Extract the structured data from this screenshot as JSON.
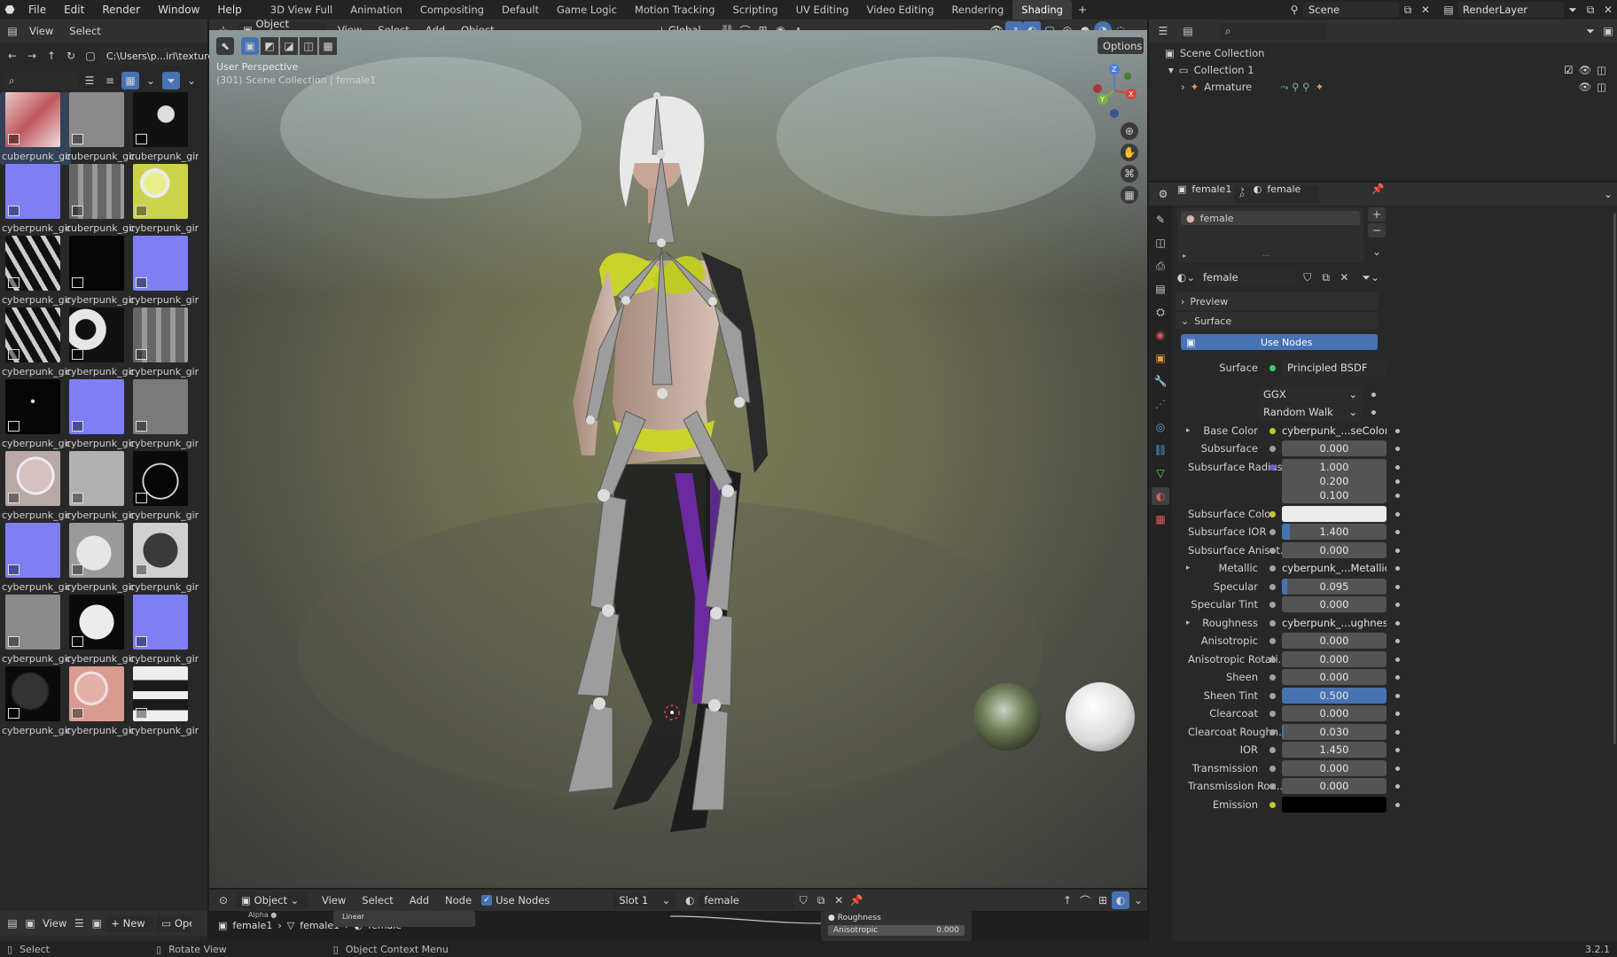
{
  "topbar": {
    "menus": [
      "File",
      "Edit",
      "Render",
      "Window",
      "Help"
    ],
    "workspaces": [
      "3D View Full",
      "Animation",
      "Compositing",
      "Default",
      "Game Logic",
      "Motion Tracking",
      "Scripting",
      "UV Editing",
      "Video Editing",
      "Rendering",
      "Shading"
    ],
    "active_workspace": "Shading",
    "scene": "Scene",
    "render_layer": "RenderLayer"
  },
  "filebrowser": {
    "menus": [
      "View",
      "Select"
    ],
    "path": "C:\\Users\\p...irl\\textures\\",
    "items": [
      {
        "label": "cuberpunk_gir",
        "kind": "redcloth"
      },
      {
        "label": "cuberpunk_gir",
        "kind": "gray"
      },
      {
        "label": "cuberpunk_gir",
        "kind": "blackmask"
      },
      {
        "label": "cyberpunk_gir",
        "kind": "normal"
      },
      {
        "label": "cuberpunk_gir",
        "kind": "grayuv"
      },
      {
        "label": "cyberpunk_gir",
        "kind": "yellow"
      },
      {
        "label": "cyberpunk_gir",
        "kind": "bwmask"
      },
      {
        "label": "cyberpunk_gir",
        "kind": "black"
      },
      {
        "label": "cyberpunk_gir",
        "kind": "normal"
      },
      {
        "label": "cyberpunk_gir",
        "kind": "bwmask"
      },
      {
        "label": "cyberpunk_gir",
        "kind": "bwuv"
      },
      {
        "label": "cyberpunk_gir",
        "kind": "grayuv"
      },
      {
        "label": "cyberpunk_gir",
        "kind": "blackdot"
      },
      {
        "label": "cyberpunk_gir",
        "kind": "normal"
      },
      {
        "label": "cyberpunk_gir",
        "kind": "graynoise"
      },
      {
        "label": "cyberpunk_gir",
        "kind": "eye"
      },
      {
        "label": "cyberpunk_gir",
        "kind": "lightgray"
      },
      {
        "label": "cyberpunk_gir",
        "kind": "blackcircle"
      },
      {
        "label": "cyberpunk_gir",
        "kind": "normal"
      },
      {
        "label": "cyberpunk_gir",
        "kind": "circles"
      },
      {
        "label": "cyberpunk_gir",
        "kind": "darkcircle"
      },
      {
        "label": "cyberpunk_gir",
        "kind": "gray"
      },
      {
        "label": "cyberpunk_gir",
        "kind": "whitecircle"
      },
      {
        "label": "cyberpunk_gir",
        "kind": "normal"
      },
      {
        "label": "cyberpunk_gir",
        "kind": "darkball"
      },
      {
        "label": "cyberpunk_gir",
        "kind": "skin"
      },
      {
        "label": "cyberpunk_gir",
        "kind": "lashes"
      }
    ],
    "bottom": {
      "view": "View",
      "new": "New",
      "open": "Open"
    }
  },
  "viewport_header": {
    "mode": "Object Mode",
    "menus": [
      "View",
      "Select",
      "Add",
      "Object"
    ],
    "orientation": "Global",
    "options": "Options",
    "overlay_line1": "User Perspective",
    "overlay_line2": "(301) Scene Collection | female1"
  },
  "node_header": {
    "object": "Object",
    "menus": [
      "View",
      "Select",
      "Add",
      "Node"
    ],
    "use_nodes": "Use Nodes",
    "slot": "Slot 1",
    "material": "female",
    "breadcrumb": [
      "female1",
      "female1",
      "female"
    ],
    "node_socket_1": "Roughness",
    "node_socket_2": "Anisotropic",
    "node_socket_2_value": "0.000",
    "mini_labels": [
      "Alpha",
      "Linear"
    ]
  },
  "outliner": {
    "root": "Scene Collection",
    "collection": "Collection 1",
    "object": "Armature"
  },
  "properties": {
    "breadcrumb_object": "female1",
    "breadcrumb_material": "female",
    "slot_material": "female",
    "material_name": "female",
    "panel_preview": "Preview",
    "panel_surface": "Surface",
    "use_nodes_button": "Use Nodes",
    "surface_label": "Surface",
    "surface_shader": "Principled BSDF",
    "distribution": "GGX",
    "subsurface_method": "Random Walk",
    "rows": [
      {
        "label": "Base Color",
        "type": "tex",
        "value": "cyberpunk_...seColor.png",
        "dot": "#c7c729",
        "arrow": true
      },
      {
        "label": "Subsurface",
        "type": "num",
        "value": "0.000",
        "dot": "#a1a1a1",
        "fill": 0
      },
      {
        "label": "Subsurface Radius",
        "type": "num",
        "value": "1.000",
        "dot": "#6363c7",
        "fill": 0
      },
      {
        "label": "",
        "type": "num",
        "value": "0.200",
        "dot": "",
        "fill": 0
      },
      {
        "label": "",
        "type": "num",
        "value": "0.100",
        "dot": "",
        "fill": 0
      },
      {
        "label": "Subsurface Color",
        "type": "color",
        "value": "",
        "dot": "#c7c729"
      },
      {
        "label": "Subsurface IOR",
        "type": "num",
        "value": "1.400",
        "dot": "#a1a1a1",
        "fill": 0.08
      },
      {
        "label": "Subsurface Anisot...",
        "type": "num",
        "value": "0.000",
        "dot": "#a1a1a1",
        "fill": 0
      },
      {
        "label": "Metallic",
        "type": "tex",
        "value": "cyberpunk_...Metallic.png",
        "dot": "#a1a1a1",
        "arrow": true
      },
      {
        "label": "Specular",
        "type": "num",
        "value": "0.095",
        "dot": "#a1a1a1",
        "fill": 0.05
      },
      {
        "label": "Specular Tint",
        "type": "num",
        "value": "0.000",
        "dot": "#a1a1a1",
        "fill": 0
      },
      {
        "label": "Roughness",
        "type": "tex",
        "value": "cyberpunk_...ughness.png",
        "dot": "#a1a1a1",
        "arrow": true
      },
      {
        "label": "Anisotropic",
        "type": "num",
        "value": "0.000",
        "dot": "#a1a1a1",
        "fill": 0
      },
      {
        "label": "Anisotropic Rotati...",
        "type": "num",
        "value": "0.000",
        "dot": "#a1a1a1",
        "fill": 0
      },
      {
        "label": "Sheen",
        "type": "num",
        "value": "0.000",
        "dot": "#a1a1a1",
        "fill": 0
      },
      {
        "label": "Sheen Tint",
        "type": "num",
        "value": "0.500",
        "dot": "#a1a1a1",
        "fill": 1
      },
      {
        "label": "Clearcoat",
        "type": "num",
        "value": "0.000",
        "dot": "#a1a1a1",
        "fill": 0
      },
      {
        "label": "Clearcoat Roughn...",
        "type": "num",
        "value": "0.030",
        "dot": "#a1a1a1",
        "fill": 0.02
      },
      {
        "label": "IOR",
        "type": "num",
        "value": "1.450",
        "dot": "#a1a1a1",
        "fill": 0
      },
      {
        "label": "Transmission",
        "type": "num",
        "value": "0.000",
        "dot": "#a1a1a1",
        "fill": 0
      },
      {
        "label": "Transmission Rou...",
        "type": "num",
        "value": "0.000",
        "dot": "#a1a1a1",
        "fill": 0
      },
      {
        "label": "Emission",
        "type": "black",
        "value": "",
        "dot": "#c7c729"
      }
    ]
  },
  "statusbar": {
    "select": "Select",
    "rotate": "Rotate View",
    "context": "Object Context Menu",
    "version": "3.2.1"
  }
}
